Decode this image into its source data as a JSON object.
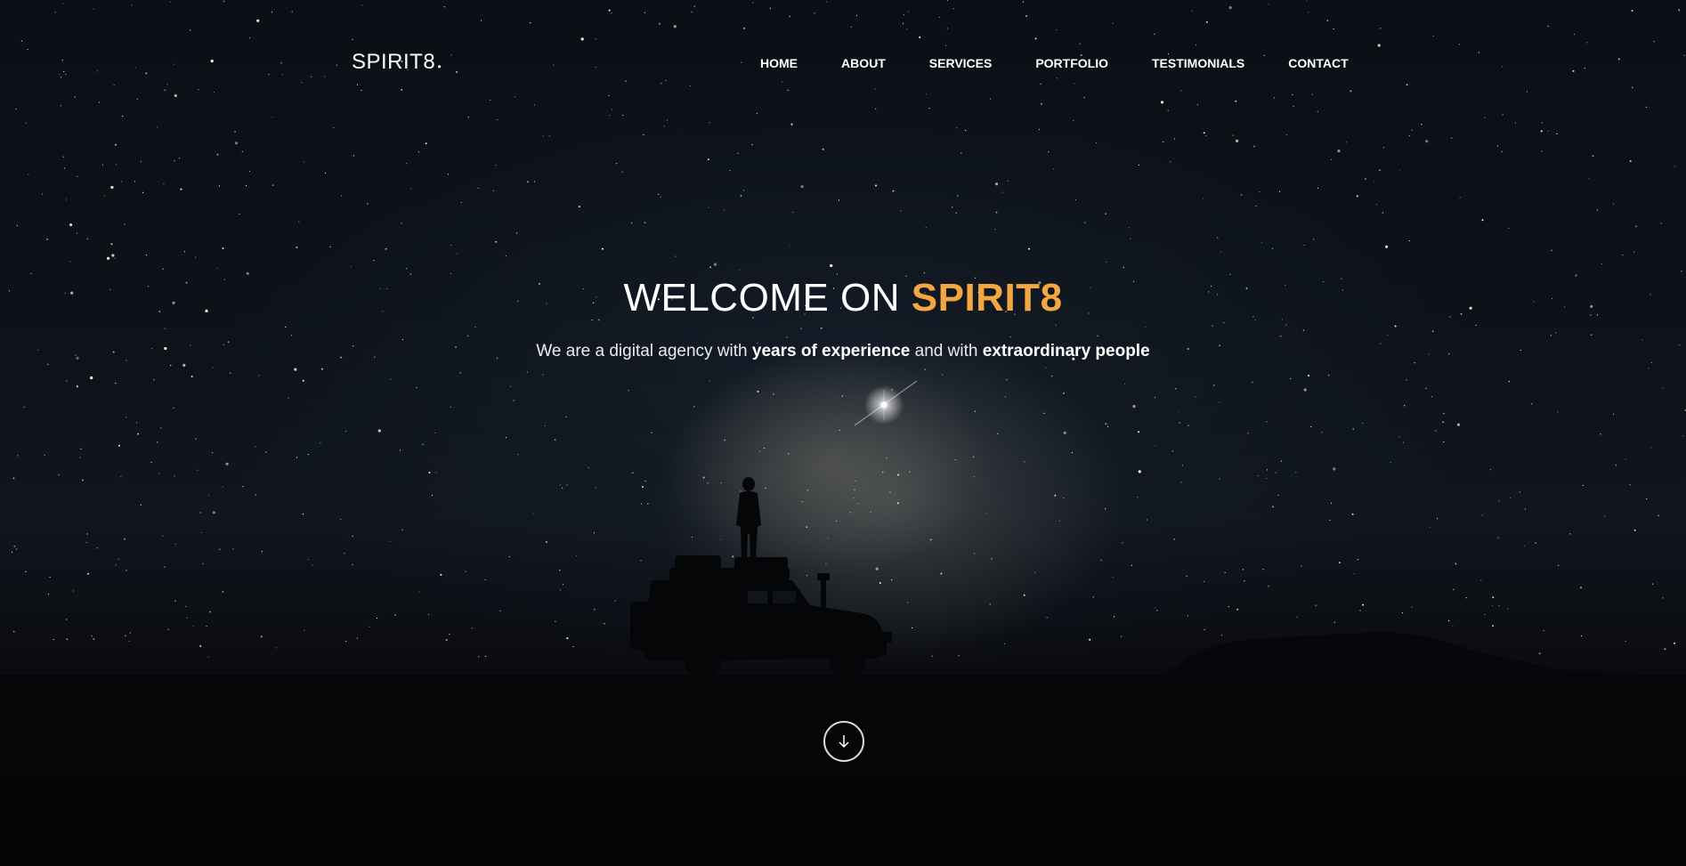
{
  "brand": {
    "logo_text": "SPIRIT8"
  },
  "nav": {
    "items": [
      {
        "label": "HOME"
      },
      {
        "label": "ABOUT"
      },
      {
        "label": "SERVICES"
      },
      {
        "label": "PORTFOLIO"
      },
      {
        "label": "TESTIMONIALS"
      },
      {
        "label": "CONTACT"
      }
    ]
  },
  "hero": {
    "headline_prefix": "WELCOME ON",
    "headline_accent": "SPIRIT8",
    "sub_part1": "We are a digital agency with",
    "sub_bold1": "years of experience",
    "sub_part2": "and with",
    "sub_bold2": "extraordinary people",
    "scroll_icon": "arrow-down-icon"
  },
  "colors": {
    "accent": "#f2a742",
    "background": "#05070b",
    "text": "#ffffff"
  }
}
